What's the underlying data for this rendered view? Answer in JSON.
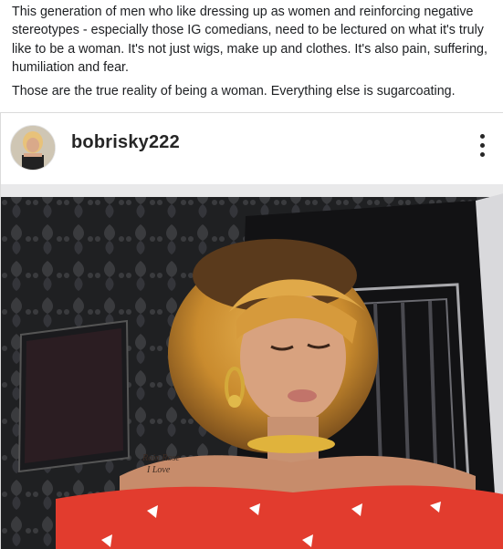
{
  "post": {
    "paragraphs": [
      "This generation of men who like dressing up as women and reinforcing negative stereotypes - especially those IG comedians, need to be lectured on what it's truly like to be a woman. It's not just wigs, make up and clothes. It's also pain, suffering, humiliation and fear.",
      "Those are the true reality of being a woman. Everything else is sugarcoating."
    ]
  },
  "embed": {
    "username": "bobrisky222",
    "avatar_icon": "profile-photo",
    "more_icon": "vertical-ellipsis-icon",
    "media_description_icon": "video-frame"
  },
  "colors": {
    "text": "#1c1e21",
    "username": "#262626",
    "border": "#dbdbdb",
    "dress_red": "#e23c2e"
  }
}
